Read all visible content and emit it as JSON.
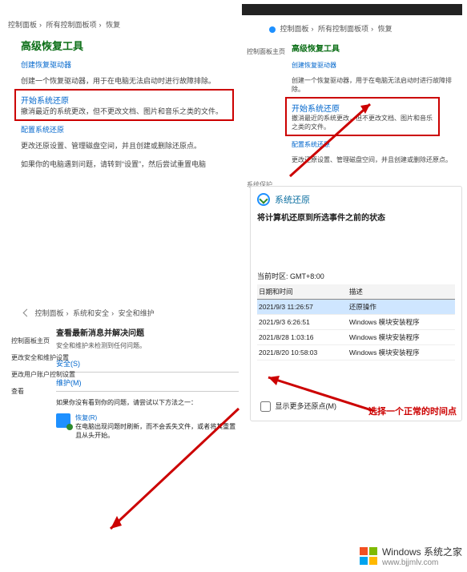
{
  "panel1": {
    "breadcrumb": [
      "控制面板",
      "所有控制面板项",
      "恢复"
    ],
    "heading": "高级恢复工具",
    "item1_link": "创建恢复驱动器",
    "item1_desc": "创建一个恢复驱动器，用于在电脑无法启动时进行故障排除。",
    "boxed_link": "开始系统还原",
    "boxed_desc": "撤消最近的系统更改，但不更改文档、图片和音乐之类的文件。",
    "item3_link": "配置系统还原",
    "item3_desc": "更改还原设置、管理磁盘空间，并且创建或删除还原点。",
    "note": "如果你的电脑遇到问题，请转到“设置”，然后尝试重置电脑"
  },
  "panel2": {
    "breadcrumb": [
      "控制面板",
      "所有控制面板项",
      "恢复"
    ],
    "side_label": "控制面板主页",
    "heading": "高级恢复工具",
    "item1_link": "创建恢复驱动器",
    "item1_desc": "创建一个恢复驱动器，用于在电脑无法启动时进行故障排除。",
    "boxed_link": "开始系统还原",
    "boxed_desc": "撤消最近的系统更改，但不更改文档、图片和音乐之类的文件。",
    "item3_link": "配置系统还原",
    "item3_desc": "更改还原设置、管理磁盘空间，并且创建或删除还原点。"
  },
  "panel3": {
    "breadcrumb": [
      "控制面板",
      "系统和安全",
      "安全和维护"
    ],
    "side_items": [
      "控制面板主页",
      "更改安全和维护设置",
      "更改用户账户控制设置",
      "查看"
    ],
    "heading": "查看最新消息并解决问题",
    "sub": "安全和维护未检测到任何问题。",
    "sec_link": "安全(S)",
    "maint_link": "维护(M)",
    "q": "如果你没有看到你的问题，请尝试以下方法之一：",
    "rec_title": "恢复(R)",
    "rec_desc": "在电脑出现问题时刷新，而不会丢失文件，或者将其重置且从头开始。"
  },
  "panel4": {
    "top_label": "系统保护",
    "header": "系统还原",
    "title": "将计算机还原到所选事件之前的状态",
    "tz_label": "当前时区: GMT+8:00",
    "columns": [
      "日期和时间",
      "描述"
    ],
    "rows": [
      {
        "dt": "2021/9/3 11:26:57",
        "desc": "还原操作"
      },
      {
        "dt": "2021/9/3 6:26:51",
        "desc": "Windows 模块安装程序"
      },
      {
        "dt": "2021/8/28 1:03:16",
        "desc": "Windows 模块安装程序"
      },
      {
        "dt": "2021/8/20 10:58:03",
        "desc": "Windows 模块安装程序"
      }
    ],
    "annotation": "选择一个正常的时间点",
    "checkbox_label": "显示更多还原点(M)"
  },
  "watermark": {
    "brand": "Windows 系统之家",
    "url": "www.bjjmlv.com"
  }
}
